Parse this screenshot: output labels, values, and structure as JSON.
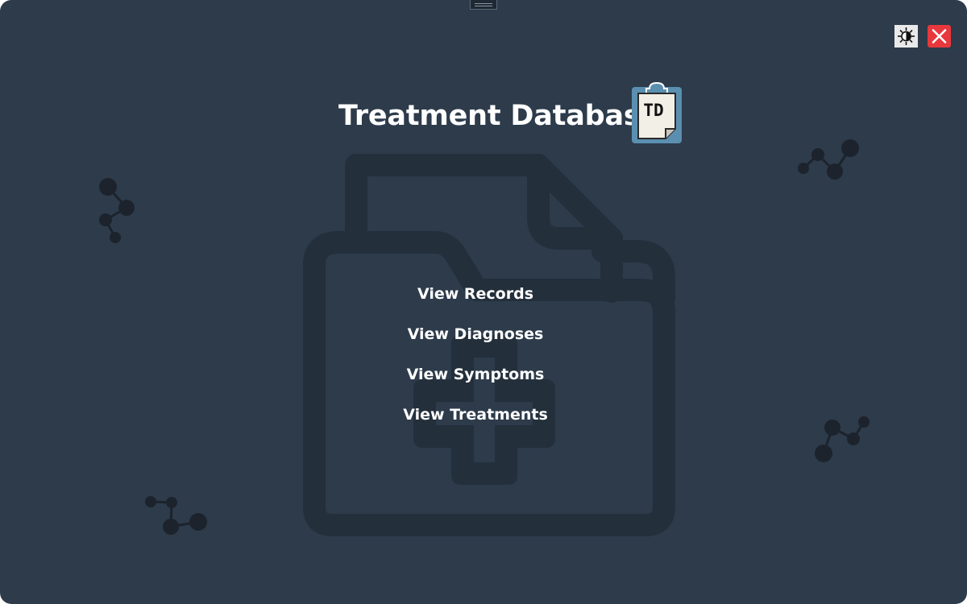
{
  "app": {
    "title": "Treatment Database",
    "logo_text": "TD"
  },
  "toolbar": {
    "theme_toggle_icon": "contrast-sun-icon",
    "close_icon": "close-icon"
  },
  "menu": {
    "items": [
      {
        "label": "View Records"
      },
      {
        "label": "View Diagnoses"
      },
      {
        "label": "View Symptoms"
      },
      {
        "label": "View Treatments"
      }
    ]
  },
  "colors": {
    "background": "#2d3b4b",
    "decoration": "#232f3b",
    "molecule": "#1c232c",
    "logo_frame": "#5b8fb0",
    "close": "#e8383d",
    "text": "#ffffff"
  }
}
